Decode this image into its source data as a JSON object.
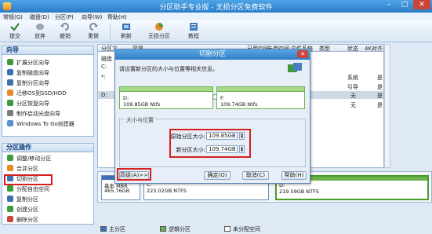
{
  "window": {
    "title": "分区助手专业版 - 无损分区免费软件"
  },
  "menu": [
    "常规(G)",
    "磁盘(D)",
    "分区(P)",
    "向导(W)",
    "帮助(H)"
  ],
  "toolbar": [
    {
      "label": "提交",
      "icon": "checkmark-icon"
    },
    {
      "label": "放弃",
      "icon": "discard-icon"
    },
    {
      "label": "撤销",
      "icon": "undo-icon"
    },
    {
      "label": "重做",
      "icon": "redo-icon"
    },
    {
      "label": "刷新",
      "icon": "refresh-icon"
    },
    {
      "label": "无损分区",
      "icon": "partition-icon"
    },
    {
      "label": "教程",
      "icon": "tutorial-icon"
    }
  ],
  "wizard": {
    "title": "向导",
    "items": [
      "扩展分区向导",
      "复制磁盘向导",
      "复制分区向导",
      "迁移OS到SSD/HDD",
      "分区恢复向导",
      "制作启动光盘向导",
      "Windows To Go创建器"
    ]
  },
  "ops": {
    "title": "分区操作",
    "items": [
      "调整/移动分区",
      "合并分区",
      "切割分区",
      "分配自由空间",
      "复制分区",
      "创建分区",
      "删除分区"
    ]
  },
  "list": {
    "columns": [
      "分区",
      "文",
      "容量",
      "已用空间",
      "未用空间",
      "文件系统",
      "类型",
      "状态",
      "4K对齐"
    ],
    "rows": [
      {
        "part": "磁盘",
        "status": "",
        "align": ""
      },
      {
        "part": "C:",
        "status": "系统",
        "align": "是"
      },
      {
        "part": "*:",
        "status": "引导",
        "align": "是"
      },
      {
        "part": "D:",
        "status": "无",
        "align": "是"
      },
      {
        "part": "",
        "status": "无",
        "align": "是"
      }
    ]
  },
  "diskmap": {
    "disk": {
      "line1": "基本 MBR",
      "line2": "465.76GB"
    },
    "c": {
      "line1": "C:",
      "line2": "223.02GB NTFS"
    },
    "d": {
      "line1": "D:",
      "line2": "219.59GB NTFS"
    }
  },
  "legend": [
    "主分区",
    "逻辑分区",
    "未分配空间"
  ],
  "dialog": {
    "title": "切割分区",
    "description": "请设置新分区的大小与位置等相关信息。",
    "left": {
      "name": "D:",
      "info": "109.85GB Ntfs"
    },
    "right": {
      "name": "F:",
      "info": "109.74GB Ntfs"
    },
    "group": "大小与位置",
    "original_label": "原始分区大小:",
    "original_value": "109.85GB",
    "new_label": "新分区大小:",
    "new_value": "109.74GB",
    "advanced": "高级(A)>>",
    "ok": "确定(O)",
    "cancel": "取消(C)",
    "help": "帮助(H)"
  },
  "colors": {
    "accent": "#2f7dc5",
    "highlight": "#d62020",
    "primary": "#3d71b4",
    "green": "#6bb24b"
  }
}
